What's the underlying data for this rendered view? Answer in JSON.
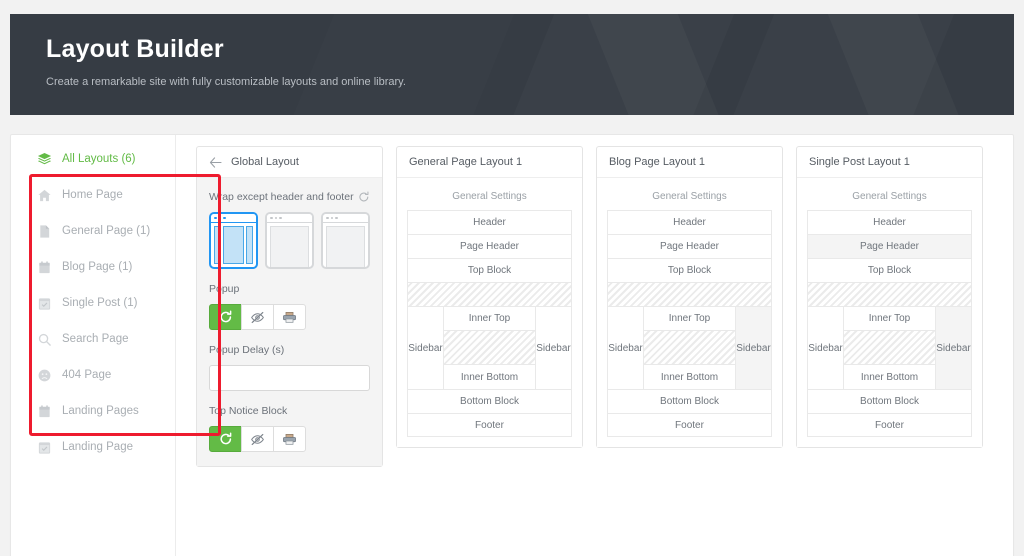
{
  "hero": {
    "title": "Layout Builder",
    "subtitle": "Create a remarkable site with fully customizable layouts and online library."
  },
  "colors": {
    "accent_green": "#63bb46",
    "hero_bg": "#363c44",
    "selected_blue": "#2196f3",
    "annotation_red": "#ee1b2e"
  },
  "sidebar": {
    "items": [
      {
        "label": "All Layouts (6)",
        "icon": "layers-icon",
        "active": true
      },
      {
        "label": "Home Page",
        "icon": "home-icon",
        "active": false
      },
      {
        "label": "General Page (1)",
        "icon": "document-icon",
        "active": false
      },
      {
        "label": "Blog Page (1)",
        "icon": "calendar-icon",
        "active": false
      },
      {
        "label": "Single Post (1)",
        "icon": "calendar-check-icon",
        "active": false
      },
      {
        "label": "Search Page",
        "icon": "search-icon",
        "active": false
      },
      {
        "label": "404 Page",
        "icon": "sad-face-icon",
        "active": false
      },
      {
        "label": "Landing Pages",
        "icon": "calendar-icon",
        "active": false
      },
      {
        "label": "Landing Page",
        "icon": "calendar-check-icon",
        "active": false
      }
    ]
  },
  "global_layout_card": {
    "title": "Global Layout",
    "back_icon": "arrow-left-icon",
    "wrap_field": {
      "label": "Wrap except header and footer",
      "reset_icon": "refresh-icon",
      "options": [
        {
          "name": "three-column-wrap",
          "selected": true
        },
        {
          "name": "plain-wrap-a",
          "selected": false
        },
        {
          "name": "plain-wrap-b",
          "selected": false
        }
      ]
    },
    "popup": {
      "label": "Popup",
      "buttons": [
        {
          "icon": "refresh-icon",
          "name": "popup-default",
          "active": true
        },
        {
          "icon": "eye-off-icon",
          "name": "popup-hide",
          "active": false
        },
        {
          "icon": "printer-icon",
          "name": "popup-print",
          "active": false
        }
      ]
    },
    "popup_delay": {
      "label": "Popup Delay (s)",
      "value": "",
      "placeholder": ""
    },
    "top_notice_block": {
      "label": "Top Notice Block",
      "buttons": [
        {
          "icon": "refresh-icon",
          "name": "notice-default",
          "active": true
        },
        {
          "icon": "eye-off-icon",
          "name": "notice-hide",
          "active": false
        },
        {
          "icon": "printer-icon",
          "name": "notice-print",
          "active": false
        }
      ]
    }
  },
  "layout_cards": [
    {
      "title": "General Page Layout 1",
      "general_settings": "General Settings",
      "header": "Header",
      "page_header": "Page Header",
      "page_header_shaded": false,
      "top_block": "Top Block",
      "sidebar_left": "Sidebar",
      "sidebar_right": "Sidebar",
      "sidebar_right_shaded": false,
      "inner_top": "Inner Top",
      "inner_bottom": "Inner Bottom",
      "bottom_block": "Bottom Block",
      "footer": "Footer"
    },
    {
      "title": "Blog Page Layout 1",
      "general_settings": "General Settings",
      "header": "Header",
      "page_header": "Page Header",
      "page_header_shaded": false,
      "top_block": "Top Block",
      "sidebar_left": "Sidebar",
      "sidebar_right": "Sidebar",
      "sidebar_right_shaded": true,
      "inner_top": "Inner Top",
      "inner_bottom": "Inner Bottom",
      "bottom_block": "Bottom Block",
      "footer": "Footer"
    },
    {
      "title": "Single Post Layout 1",
      "general_settings": "General Settings",
      "header": "Header",
      "page_header": "Page Header",
      "page_header_shaded": true,
      "top_block": "Top Block",
      "sidebar_left": "Sidebar",
      "sidebar_right": "Sidebar",
      "sidebar_right_shaded": true,
      "inner_top": "Inner Top",
      "inner_bottom": "Inner Bottom",
      "bottom_block": "Bottom Block",
      "footer": "Footer"
    }
  ]
}
